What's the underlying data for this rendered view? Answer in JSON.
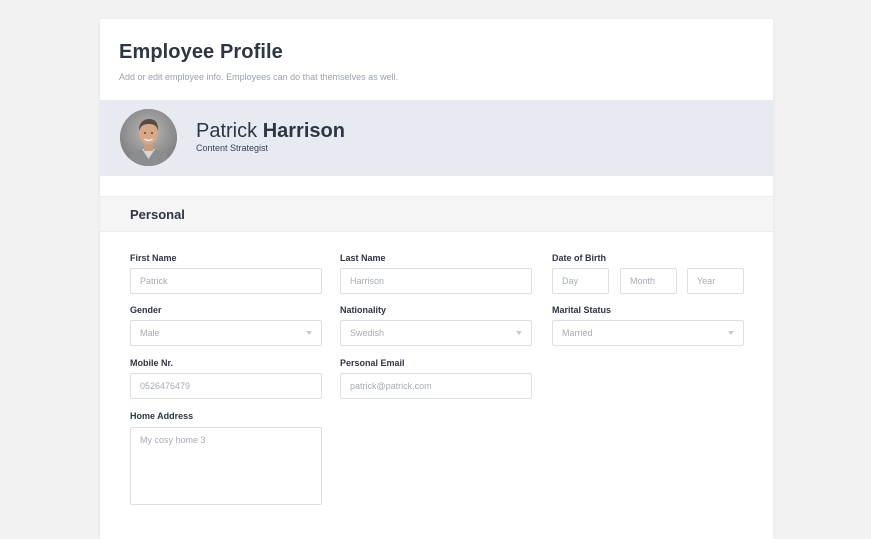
{
  "header": {
    "title": "Employee Profile",
    "subtitle": "Add or edit employee info. Employees can do that themselves as well."
  },
  "profile": {
    "first_name": "Patrick",
    "last_name": "Harrison",
    "role": "Content Strategist"
  },
  "section": {
    "title": "Personal"
  },
  "form": {
    "first_name": {
      "label": "First Name",
      "placeholder": "Patrick"
    },
    "last_name": {
      "label": "Last Name",
      "placeholder": "Harrison"
    },
    "date_of_birth": {
      "label": "Date of Birth",
      "day_placeholder": "Day",
      "month_placeholder": "Month",
      "year_placeholder": "Year"
    },
    "gender": {
      "label": "Gender",
      "value": "Male"
    },
    "nationality": {
      "label": "Nationality",
      "value": "Swedish"
    },
    "marital_status": {
      "label": "Marital Status",
      "value": "Married"
    },
    "mobile": {
      "label": "Mobile Nr.",
      "placeholder": "0526476479"
    },
    "personal_email": {
      "label": "Personal Email",
      "placeholder": "patrick@patrick.com"
    },
    "home_address": {
      "label": "Home Address",
      "placeholder": "My cosy home 3"
    }
  },
  "icons": {
    "select_arrow": "chevron-down-icon",
    "avatar": "avatar"
  },
  "colors": {
    "background": "#f2f2f2",
    "card": "#ffffff",
    "banner": "#e8eaf2",
    "section_bar": "#f5f5f5",
    "text_dark": "#2e3545",
    "text_muted": "#9aa1ad",
    "input_border": "#dcdfe5"
  }
}
